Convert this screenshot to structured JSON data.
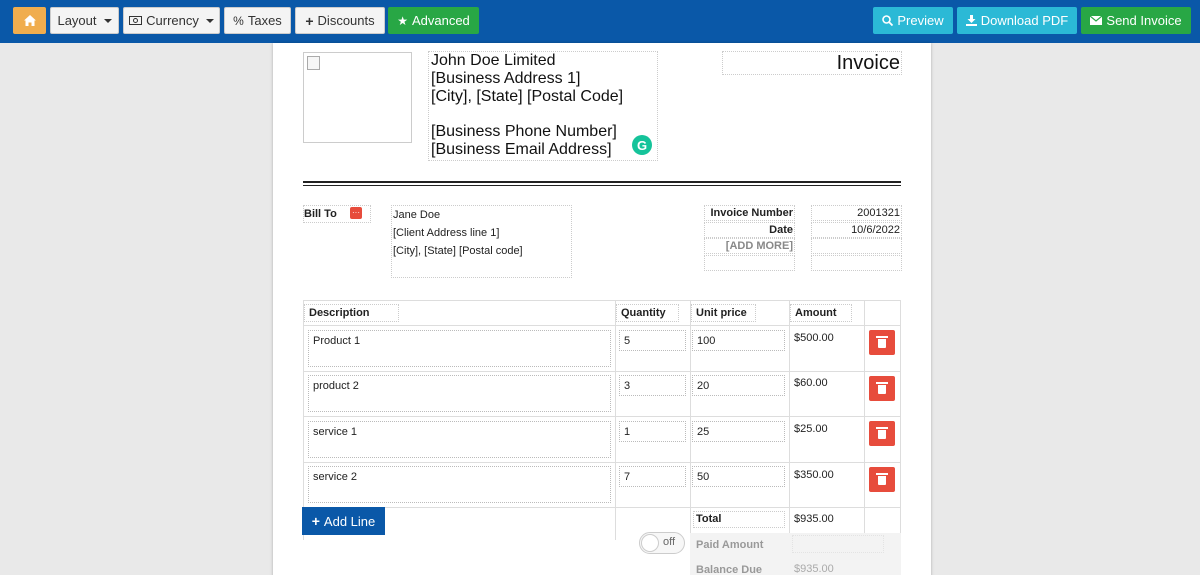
{
  "toolbar": {
    "home_icon": "home-icon",
    "layout": "Layout",
    "currency": "Currency",
    "taxes": "Taxes",
    "discounts": "Discounts",
    "advanced": "Advanced",
    "preview": "Preview",
    "download_pdf": "Download PDF",
    "send_invoice": "Send Invoice",
    "colors": {
      "bar": "#0a58a8",
      "home": "#f0ad4e",
      "green": "#28a745",
      "cyan": "#2bb9d6"
    }
  },
  "business": {
    "name": "John Doe Limited",
    "address1": "[Business Address 1]",
    "city_line": "[City], [State] [Postal Code]",
    "phone": "[Business Phone Number]",
    "email": "[Business Email Address]"
  },
  "invoice_title": "Invoice",
  "bill_to": {
    "label": "Bill To",
    "name": "Jane Doe",
    "address1": "[Client Address line 1]",
    "city_line": "[City], [State] [Postal code]"
  },
  "meta": {
    "invoice_number_label": "Invoice Number",
    "invoice_number": "2001321",
    "date_label": "Date",
    "date": "10/6/2022",
    "add_more": "[ADD MORE]"
  },
  "table": {
    "headers": {
      "description": "Description",
      "quantity": "Quantity",
      "unit_price": "Unit price",
      "amount": "Amount"
    },
    "rows": [
      {
        "description": "Product 1",
        "quantity": "5",
        "unit_price": "100",
        "amount": "$500.00"
      },
      {
        "description": "product 2",
        "quantity": "3",
        "unit_price": "20",
        "amount": "$60.00"
      },
      {
        "description": "service 1",
        "quantity": "1",
        "unit_price": "25",
        "amount": "$25.00"
      },
      {
        "description": "service 2",
        "quantity": "7",
        "unit_price": "50",
        "amount": "$350.00"
      }
    ]
  },
  "add_line": "Add Line",
  "toggle": {
    "label": "off"
  },
  "totals": {
    "total_label": "Total",
    "total": "$935.00",
    "paid_label": "Paid Amount",
    "balance_label": "Balance Due",
    "balance": "$935.00"
  },
  "delete_color": "#e74c3c"
}
